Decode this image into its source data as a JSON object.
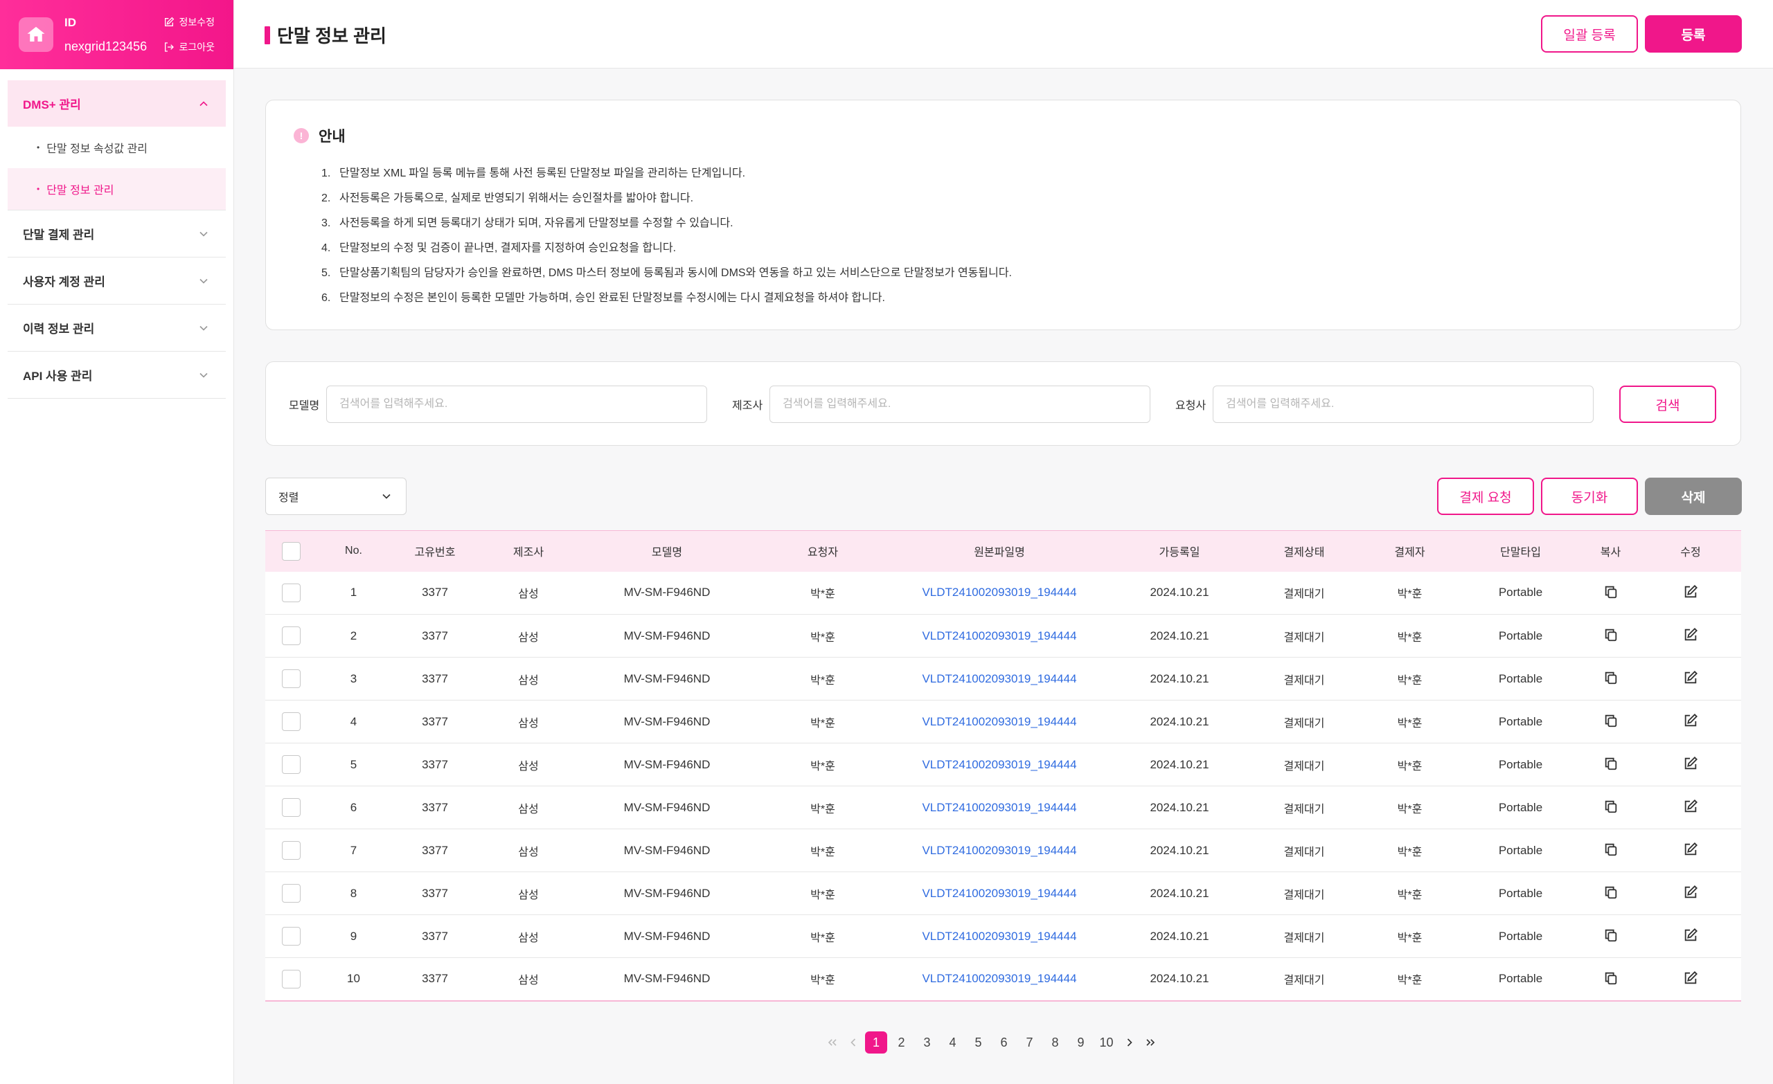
{
  "user": {
    "id_label": "ID",
    "id_value": "nexgrid123456",
    "edit_label": "정보수정",
    "logout_label": "로그아웃"
  },
  "sidebar": {
    "groups": [
      {
        "label": "DMS+ 관리",
        "expanded": true,
        "sub_items": [
          "단말 정보 속성값 관리",
          "단말 정보 관리"
        ]
      },
      {
        "label": "단말 결제 관리"
      },
      {
        "label": "사용자 계정 관리"
      },
      {
        "label": "이력 정보 관리"
      },
      {
        "label": "API 사용 관리"
      }
    ]
  },
  "header": {
    "title": "단말 정보 관리",
    "bulk_register_label": "일괄 등록",
    "register_label": "등록"
  },
  "notice": {
    "title": "안내",
    "icon": "info-icon",
    "items": [
      {
        "num": "1.",
        "text": "단말정보 XML 파일 등록 메뉴를 통해 사전 등록된 단말정보 파일을 관리하는 단계입니다."
      },
      {
        "num": "2.",
        "text": "사전등록은 가등록으로, 실제로 반영되기 위해서는 승인절차를 밟아야 합니다."
      },
      {
        "num": "3.",
        "text": "사전등록을 하게 되면 등록대기 상태가 되며, 자유롭게 단말정보를 수정할 수 있습니다."
      },
      {
        "num": "4.",
        "text": "단말정보의 수정 및 검증이 끝나면, 결제자를 지정하여 승인요청을 합니다."
      },
      {
        "num": "5.",
        "text": "단말상품기획팀의 담당자가 승인을 완료하면, DMS 마스터 정보에 등록됨과 동시에 DMS와 연동을 하고 있는 서비스단으로 단말정보가 연동됩니다."
      },
      {
        "num": "6.",
        "text": "단말정보의 수정은 본인이 등록한 모델만 가능하며, 승인 완료된 단말정보를 수정시에는 다시 결제요청을 하셔야 합니다."
      }
    ]
  },
  "search": {
    "model_label": "모델명",
    "maker_label": "제조사",
    "requester_label": "요청사",
    "placeholder": "검색어를 입력해주세요.",
    "button_label": "검색"
  },
  "toolbar": {
    "sort_label": "정렬",
    "approve_label": "결제 요청",
    "sync_label": "동기화",
    "delete_label": "삭제"
  },
  "table": {
    "headers": [
      "No.",
      "고유번호",
      "제조사",
      "모델명",
      "요청자",
      "원본파일명",
      "가등록일",
      "결제상태",
      "결제자",
      "단말타입",
      "복사",
      "수정"
    ],
    "rows": [
      {
        "no": "1",
        "uid": "3377",
        "maker": "삼성",
        "model": "MV-SM-F946ND",
        "requester": "박*훈",
        "file": "VLDT241002093019_194444",
        "date": "2024.10.21",
        "status": "결제대기",
        "approver": "박*훈",
        "type": "Portable"
      },
      {
        "no": "2",
        "uid": "3377",
        "maker": "삼성",
        "model": "MV-SM-F946ND",
        "requester": "박*훈",
        "file": "VLDT241002093019_194444",
        "date": "2024.10.21",
        "status": "결제대기",
        "approver": "박*훈",
        "type": "Portable"
      },
      {
        "no": "3",
        "uid": "3377",
        "maker": "삼성",
        "model": "MV-SM-F946ND",
        "requester": "박*훈",
        "file": "VLDT241002093019_194444",
        "date": "2024.10.21",
        "status": "결제대기",
        "approver": "박*훈",
        "type": "Portable"
      },
      {
        "no": "4",
        "uid": "3377",
        "maker": "삼성",
        "model": "MV-SM-F946ND",
        "requester": "박*훈",
        "file": "VLDT241002093019_194444",
        "date": "2024.10.21",
        "status": "결제대기",
        "approver": "박*훈",
        "type": "Portable"
      },
      {
        "no": "5",
        "uid": "3377",
        "maker": "삼성",
        "model": "MV-SM-F946ND",
        "requester": "박*훈",
        "file": "VLDT241002093019_194444",
        "date": "2024.10.21",
        "status": "결제대기",
        "approver": "박*훈",
        "type": "Portable"
      },
      {
        "no": "6",
        "uid": "3377",
        "maker": "삼성",
        "model": "MV-SM-F946ND",
        "requester": "박*훈",
        "file": "VLDT241002093019_194444",
        "date": "2024.10.21",
        "status": "결제대기",
        "approver": "박*훈",
        "type": "Portable"
      },
      {
        "no": "7",
        "uid": "3377",
        "maker": "삼성",
        "model": "MV-SM-F946ND",
        "requester": "박*훈",
        "file": "VLDT241002093019_194444",
        "date": "2024.10.21",
        "status": "결제대기",
        "approver": "박*훈",
        "type": "Portable"
      },
      {
        "no": "8",
        "uid": "3377",
        "maker": "삼성",
        "model": "MV-SM-F946ND",
        "requester": "박*훈",
        "file": "VLDT241002093019_194444",
        "date": "2024.10.21",
        "status": "결제대기",
        "approver": "박*훈",
        "type": "Portable"
      },
      {
        "no": "9",
        "uid": "3377",
        "maker": "삼성",
        "model": "MV-SM-F946ND",
        "requester": "박*훈",
        "file": "VLDT241002093019_194444",
        "date": "2024.10.21",
        "status": "결제대기",
        "approver": "박*훈",
        "type": "Portable"
      },
      {
        "no": "10",
        "uid": "3377",
        "maker": "삼성",
        "model": "MV-SM-F946ND",
        "requester": "박*훈",
        "file": "VLDT241002093019_194444",
        "date": "2024.10.21",
        "status": "결제대기",
        "approver": "박*훈",
        "type": "Portable"
      }
    ]
  },
  "pagination": {
    "pages": [
      "1",
      "2",
      "3",
      "4",
      "5",
      "6",
      "7",
      "8",
      "9",
      "10"
    ],
    "current": "1"
  },
  "colors": {
    "accent": "#f0178a",
    "accent_light": "#fde8f2",
    "link": "#2f6be0",
    "delete_gray": "#8c8c8c"
  }
}
